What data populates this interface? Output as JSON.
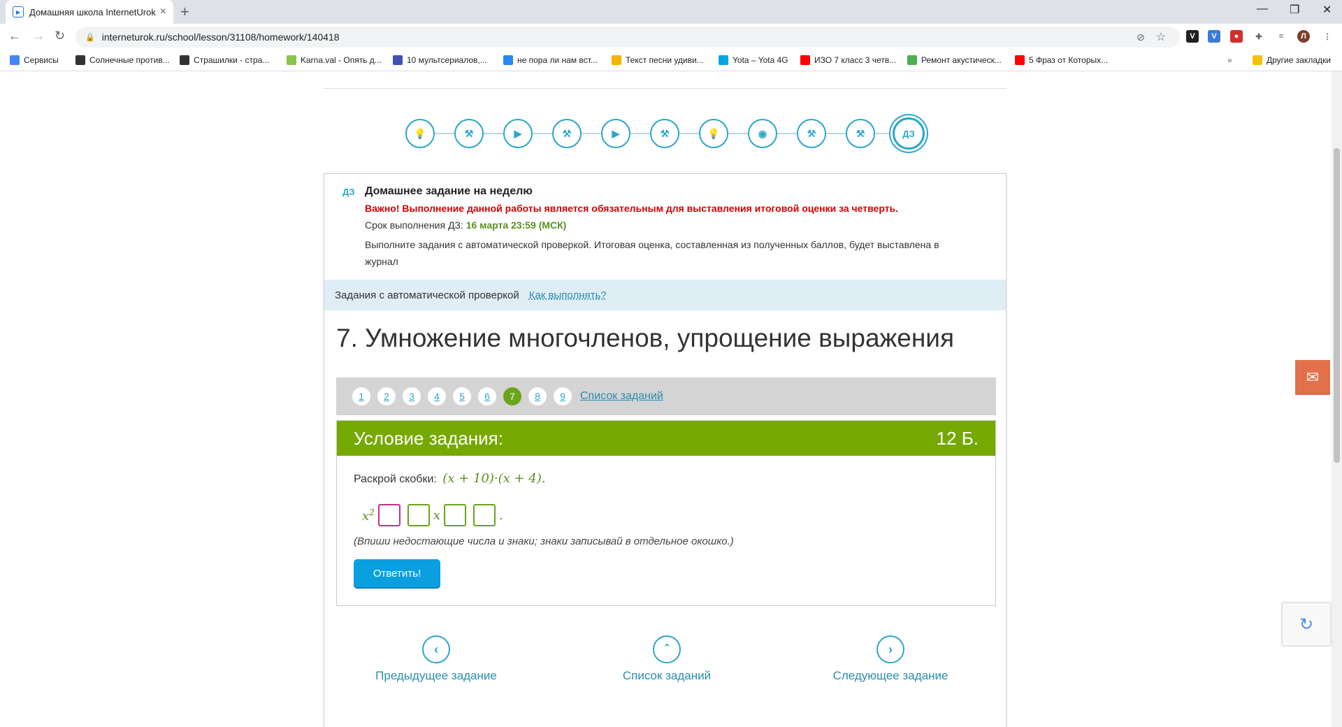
{
  "browser": {
    "tab_title": "Домашняя школа InternetUrok.r",
    "url": "interneturok.ru/school/lesson/31108/homework/140418",
    "profile_letter": "Л",
    "bookmarks": [
      {
        "label": "Сервисы",
        "color": "#4285f4"
      },
      {
        "label": "Солнечные против...",
        "color": "#333333"
      },
      {
        "label": "Страшилки - стра...",
        "color": "#333333"
      },
      {
        "label": "Karna.val - Опять д...",
        "color": "#8bc34a"
      },
      {
        "label": "10 мультсериалов,...",
        "color": "#3f51b5"
      },
      {
        "label": "не пора ли нам вст...",
        "color": "#2787f5"
      },
      {
        "label": "Текст песни удиви...",
        "color": "#f4b400"
      },
      {
        "label": "Yota – Yota 4G",
        "color": "#00a6e0"
      },
      {
        "label": "ИЗО 7 класс 3 четв...",
        "color": "#ff0000"
      },
      {
        "label": "Ремонт акустическ...",
        "color": "#4caf50"
      },
      {
        "label": "5 Фраз от Которых...",
        "color": "#ff0000"
      }
    ],
    "other_bookmarks": "Другие закладки"
  },
  "steps": [
    "bulb-icon",
    "dumbbell-icon",
    "play-icon",
    "dumbbell-icon",
    "play-icon",
    "dumbbell-icon",
    "bulb-icon",
    "webcam-icon",
    "dumbbell-icon",
    "dumbbell-advanced-icon"
  ],
  "active_step": "ДЗ",
  "homework": {
    "badge": "ДЗ",
    "title": "Домашнее задание на неделю",
    "warning": "Важно! Выполнение данной работы является обязательным для выставления итоговой оценки за четверть.",
    "deadline_label": "Срок выполнения ДЗ:",
    "deadline_value": "16 марта 23:59 (МСК)",
    "description": "Выполните задания с автоматической проверкой. Итоговая оценка, составленная из полученных баллов, будет выставлена в журнал"
  },
  "autocheck": {
    "label": "Задания с автоматической проверкой",
    "how_link": "Как выполнять?"
  },
  "task": {
    "title": "7. Умножение многочленов, упрощение выражения",
    "pages": [
      "1",
      "2",
      "3",
      "4",
      "5",
      "6",
      "7",
      "8",
      "9"
    ],
    "active_page": "7",
    "list_link": "Список заданий",
    "condition_header": "Условие задания:",
    "points": "12 Б.",
    "question": "Раскрой скобки:",
    "expression": "(x + 10)·(x + 4).",
    "ans_x2": "x",
    "ans_x2_power": "2",
    "ans_x": "x",
    "ans_end": ".",
    "hint": "(Впиши недостающие числа и знаки; знаки записывай в отдельное окошко.)",
    "submit": "Ответить!"
  },
  "bottom_nav": {
    "prev": "Предыдущее задание",
    "list": "Список заданий",
    "next": "Следующее задание"
  }
}
